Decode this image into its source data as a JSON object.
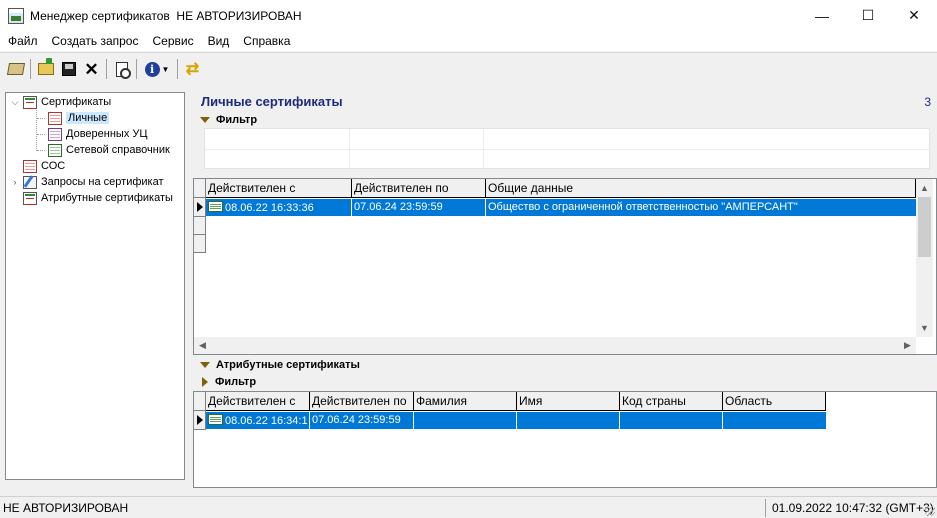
{
  "window": {
    "title": "Менеджер сертификатов  НЕ АВТОРИЗИРОВАН",
    "minimize": "—",
    "maximize": "☐",
    "close": "✕"
  },
  "menu": [
    "Файл",
    "Создать запрос",
    "Сервис",
    "Вид",
    "Справка"
  ],
  "toolbar": {
    "icons": [
      "book-icon",
      "import-icon",
      "export-icon",
      "delete-icon",
      "view-icon",
      "info-icon",
      "refresh-icon"
    ]
  },
  "tree": {
    "items": [
      {
        "label": "Сертификаты",
        "icon": "cert-folder-icon"
      },
      {
        "label": "Личные",
        "icon": "personal-cert-icon"
      },
      {
        "label": "Доверенных УЦ",
        "icon": "trusted-ca-icon"
      },
      {
        "label": "Сетевой справочник",
        "icon": "network-directory-icon"
      },
      {
        "label": "СОС",
        "icon": "crl-icon"
      },
      {
        "label": "Запросы на сертификат",
        "icon": "cert-request-icon"
      },
      {
        "label": "Атрибутные сертификаты",
        "icon": "attr-cert-icon"
      }
    ],
    "selected": "Личные"
  },
  "main": {
    "title": "Личные сертификаты",
    "count": "3",
    "filter_label": "Фильтр",
    "grid": {
      "columns": [
        "Действителен с",
        "Действителен по",
        "Общие данные"
      ],
      "rows": [
        {
          "valid_from": "08.06.22 16:33:36",
          "valid_to": "07.06.24 23:59:59",
          "common": "Общество с ограниченной ответственностью \"АМПЕРСАНТ\""
        }
      ]
    }
  },
  "attr_section": {
    "title": "Атрибутные сертификаты",
    "filter_label": "Фильтр",
    "grid": {
      "columns": [
        "Действителен с",
        "Действителен по",
        "Фамилия",
        "Имя",
        "Код страны",
        "Область"
      ],
      "rows": [
        {
          "valid_from": "08.06.22 16:34:1",
          "valid_to": "07.06.24 23:59:59",
          "surname": "",
          "name": "",
          "country": "",
          "region": ""
        }
      ]
    }
  },
  "status": {
    "left": "НЕ АВТОРИЗИРОВАН",
    "right": "01.09.2022 10:47:32 (GMT+3)"
  },
  "colors": {
    "selection": "#0078d7",
    "title_blue": "#1f2a7a",
    "tree_selected": "#cce8ff"
  }
}
